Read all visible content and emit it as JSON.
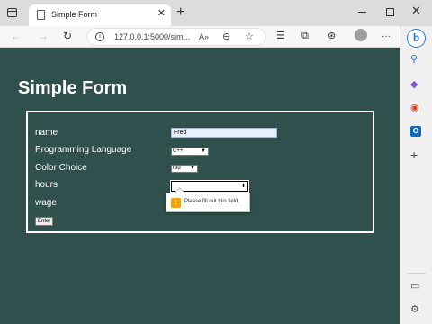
{
  "browser": {
    "tab_title": "Simple Form",
    "url": "127.0.0.1:5000/sim...",
    "icons": {
      "tab_actions": "tab-actions-icon",
      "favicon": "page-icon",
      "close_tab": "✕",
      "new_tab": "+",
      "minimize": "minimize-icon",
      "maximize": "maximize-icon",
      "close_window": "✕",
      "back": "←",
      "forward": "→",
      "refresh": "↻",
      "read_aloud": "A»",
      "zoom": "⊖",
      "favorite": "☆",
      "favorites": "☰",
      "collections": "⧉",
      "extensions": "⊛",
      "more": "···",
      "bing": "b",
      "search": "⚲",
      "tools": "◆",
      "office": "◉",
      "outlook": "O",
      "add": "+",
      "sidebar_toggle": "▭",
      "settings": "⚙"
    }
  },
  "page": {
    "title": "Simple Form",
    "form": {
      "name_label": "name",
      "name_value": "Fred",
      "language_label": "Programming Language",
      "language_value": "C++",
      "color_label": "Color Choice",
      "color_value": "red",
      "hours_label": "hours",
      "hours_value": "",
      "wage_label": "wage",
      "submit_label": "Enter"
    },
    "validation_message": "Please fill out this field."
  },
  "colors": {
    "page_background": "#2f504c",
    "text": "#ffffff",
    "input_autofill": "#e8f0fe",
    "warning": "#f0a30a"
  }
}
